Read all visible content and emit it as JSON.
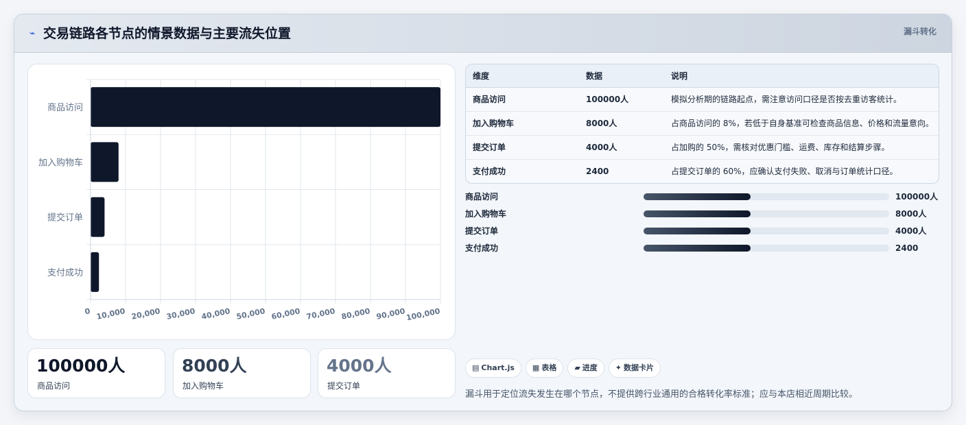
{
  "header": {
    "title": "交易链路各节点的情景数据与主要流失位置",
    "tag": "漏斗转化",
    "icon": "bolt-icon"
  },
  "chart_data": {
    "type": "bar",
    "orientation": "horizontal",
    "categories": [
      "商品访问",
      "加入购物车",
      "提交订单",
      "支付成功"
    ],
    "values": [
      100000,
      8000,
      4000,
      2400
    ],
    "xlim": [
      0,
      100000
    ],
    "xticks": [
      "0",
      "10,000",
      "20,000",
      "30,000",
      "40,000",
      "50,000",
      "60,000",
      "70,000",
      "80,000",
      "90,000",
      "100,000"
    ],
    "grid": true,
    "bar_color": "#0f172a"
  },
  "kpis": [
    {
      "value": "100000人",
      "label": "商品访问",
      "color": "#0f172a"
    },
    {
      "value": "8000人",
      "label": "加入购物车",
      "color": "#334155"
    },
    {
      "value": "4000人",
      "label": "提交订单",
      "color": "#64748b"
    }
  ],
  "table": {
    "headers": [
      "维度",
      "数据",
      "说明"
    ],
    "rows": [
      [
        "商品访问",
        "100000人",
        "模拟分析期的链路起点，需注意访问口径是否按去重访客统计。"
      ],
      [
        "加入购物车",
        "8000人",
        "占商品访问的 8%，若低于自身基准可检查商品信息、价格和流量意向。"
      ],
      [
        "提交订单",
        "4000人",
        "占加购的 50%，需核对优惠门槛、运费、库存和结算步骤。"
      ],
      [
        "支付成功",
        "2400",
        "占提交订单的 60%，应确认支付失败、取消与订单统计口径。"
      ]
    ]
  },
  "progress": [
    {
      "label": "商品访问",
      "value": "100000人",
      "fill": 0.435
    },
    {
      "label": "加入购物车",
      "value": "8000人",
      "fill": 0.435
    },
    {
      "label": "提交订单",
      "value": "4000人",
      "fill": 0.435
    },
    {
      "label": "支付成功",
      "value": "2400",
      "fill": 0.435
    }
  ],
  "chips": [
    {
      "icon": "chart-icon",
      "glyph": "▤",
      "label": "Chart.js"
    },
    {
      "icon": "table-icon",
      "glyph": "▦",
      "label": "表格"
    },
    {
      "icon": "progress-icon",
      "glyph": "▰",
      "label": "进度"
    },
    {
      "icon": "sparkle-icon",
      "glyph": "✦",
      "label": "数据卡片"
    }
  ],
  "note": "漏斗用于定位流失发生在哪个节点，不提供跨行业通用的合格转化率标准；应与本店相近周期比较。"
}
